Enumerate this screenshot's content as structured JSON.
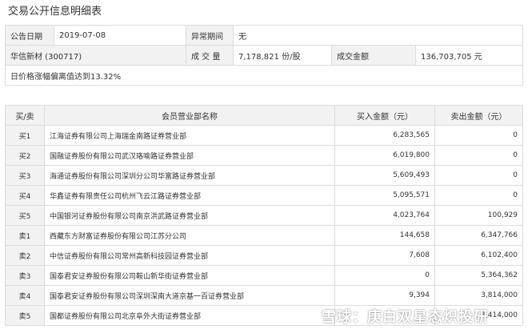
{
  "page_title": "交易公开信息明细表",
  "summary": {
    "date_label": "公告日期",
    "date_value": "2019-07-08",
    "abnormal_label": "异常期间",
    "abnormal_value": "无",
    "stock_name": "华信新材 (300717)",
    "volume_label": "成 交 量",
    "volume_value": "7,178,821 份/股",
    "amount_label": "成交金额",
    "amount_value": "136,703,705 元",
    "note": "日价格涨幅偏离值达到13.32%"
  },
  "detail": {
    "headers": [
      "买/卖",
      "会员营业部名称",
      "买入金额（元）",
      "卖出金额（元）"
    ],
    "rows": [
      {
        "side": "买1",
        "name": "江海证券有限公司上海瑞金南路证券营业部",
        "buy": "6,283,565",
        "sell": "0"
      },
      {
        "side": "买2",
        "name": "国融证券股份有限公司武汉珞喻路证券营业部",
        "buy": "6,019,800",
        "sell": "0"
      },
      {
        "side": "买3",
        "name": "海通证券股份有限公司深圳分公司华富路证券营业部",
        "buy": "5,609,493",
        "sell": "0"
      },
      {
        "side": "买4",
        "name": "华鑫证券有限责任公司杭州飞云江路证券营业部",
        "buy": "5,095,571",
        "sell": "0"
      },
      {
        "side": "买5",
        "name": "中国银河证券股份有限公司南京洪武路证券营业部",
        "buy": "4,023,764",
        "sell": "100,929"
      },
      {
        "side": "卖1",
        "name": "西藏东方财富证券股份有限公司江苏分公司",
        "buy": "144,658",
        "sell": "6,347,766"
      },
      {
        "side": "卖2",
        "name": "中信证券股份有限公司常州高新科技园证券营业部",
        "buy": "7,608",
        "sell": "6,102,400"
      },
      {
        "side": "卖3",
        "name": "国泰君安证券股份有限公司鞍山新华街证券营业部",
        "buy": "0",
        "sell": "5,364,362"
      },
      {
        "side": "卖4",
        "name": "国泰君安证券股份有限公司深圳深南大道京基一百证券营业部",
        "buy": "9,394",
        "sell": "3,814,000"
      },
      {
        "side": "卖5",
        "name": "国都证券股份有限公司北京阜外大街证券营业部",
        "buy": "",
        "sell": "3,414,000"
      }
    ]
  },
  "watermark": "雪球：庚白双星态炽投研"
}
